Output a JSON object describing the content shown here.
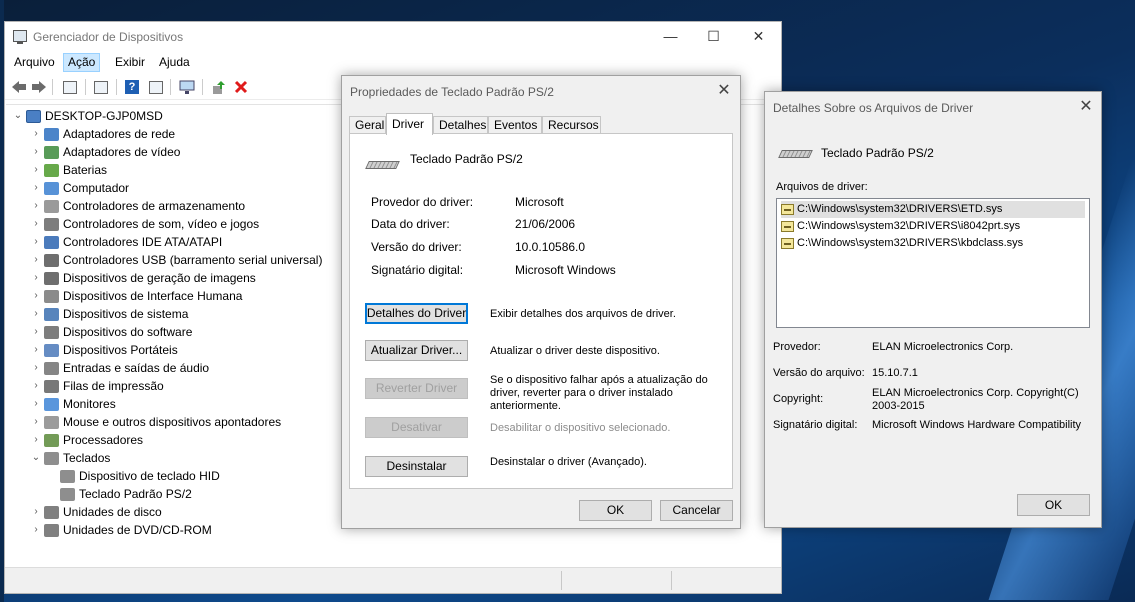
{
  "device_manager": {
    "title": "Gerenciador de Dispositivos",
    "menu": [
      "Arquivo",
      "Ação",
      "Exibir",
      "Ajuda"
    ],
    "window_buttons": {
      "minimize": "—",
      "maximize": "☐",
      "close": "✕"
    },
    "toolbar_icons": [
      "back-icon",
      "forward-icon",
      "properties-icon",
      "view-icon",
      "help-icon",
      "sheet-icon",
      "monitor-icon",
      "update-driver-icon",
      "uninstall-icon"
    ],
    "tree": {
      "root": "DESKTOP-GJP0MSD",
      "items": [
        {
          "label": "Adaptadores de rede",
          "color": "#2c6fbf"
        },
        {
          "label": "Adaptadores de vídeo",
          "color": "#3b8a3b"
        },
        {
          "label": "Baterias",
          "color": "#4c9a2a"
        },
        {
          "label": "Computador",
          "color": "#3a7fd0"
        },
        {
          "label": "Controladores de armazenamento",
          "color": "#888888"
        },
        {
          "label": "Controladores de som, vídeo e jogos",
          "color": "#666666"
        },
        {
          "label": "Controladores IDE ATA/ATAPI",
          "color": "#2b64b0"
        },
        {
          "label": "Controladores USB (barramento serial universal)",
          "color": "#555555"
        },
        {
          "label": "Dispositivos de geração de imagens",
          "color": "#555555"
        },
        {
          "label": "Dispositivos de Interface Humana",
          "color": "#777777"
        },
        {
          "label": "Dispositivos de sistema",
          "color": "#3a6fb0"
        },
        {
          "label": "Dispositivos do software",
          "color": "#666666"
        },
        {
          "label": "Dispositivos Portáteis",
          "color": "#4a78b8"
        },
        {
          "label": "Entradas e saídas de áudio",
          "color": "#707070"
        },
        {
          "label": "Filas de impressão",
          "color": "#606060"
        },
        {
          "label": "Monitores",
          "color": "#3d84d6"
        },
        {
          "label": "Mouse e outros dispositivos apontadores",
          "color": "#8a8a8a"
        },
        {
          "label": "Processadores",
          "color": "#5a8a3a"
        },
        {
          "label": "Teclados",
          "color": "#7a7a7a",
          "expanded": true
        },
        {
          "label": "Dispositivo de teclado HID",
          "color": "#7a7a7a",
          "child": true
        },
        {
          "label": "Teclado Padrão PS/2",
          "color": "#7a7a7a",
          "child": true
        },
        {
          "label": "Unidades de disco",
          "color": "#6a6a6a"
        },
        {
          "label": "Unidades de DVD/CD-ROM",
          "color": "#6a6a6a"
        }
      ]
    }
  },
  "properties": {
    "title": "Propriedades de Teclado Padrão PS/2",
    "tabs": [
      "Geral",
      "Driver",
      "Detalhes",
      "Eventos",
      "Recursos"
    ],
    "selected_tab": "Driver",
    "device_name": "Teclado Padrão PS/2",
    "fields": [
      {
        "label": "Provedor do driver:",
        "value": "Microsoft"
      },
      {
        "label": "Data do driver:",
        "value": "21/06/2006"
      },
      {
        "label": "Versão do driver:",
        "value": "10.0.10586.0"
      },
      {
        "label": "Signatário digital:",
        "value": "Microsoft Windows"
      }
    ],
    "actions": [
      {
        "button": "Detalhes do Driver",
        "desc": "Exibir detalhes dos arquivos de driver.",
        "enabled": true
      },
      {
        "button": "Atualizar Driver...",
        "desc": "Atualizar o driver deste dispositivo.",
        "enabled": true
      },
      {
        "button": "Reverter Driver",
        "desc": "Se o dispositivo falhar após a atualização do driver, reverter para o driver instalado anteriormente.",
        "enabled": false
      },
      {
        "button": "Desativar",
        "desc": "Desabilitar o dispositivo selecionado.",
        "enabled": false
      },
      {
        "button": "Desinstalar",
        "desc": "Desinstalar o driver (Avançado).",
        "enabled": true
      }
    ],
    "ok": "OK",
    "cancel": "Cancelar"
  },
  "details": {
    "title": "Detalhes Sobre os Arquivos de Driver",
    "device_name": "Teclado Padrão PS/2",
    "files_label": "Arquivos de driver:",
    "files": [
      "C:\\Windows\\system32\\DRIVERS\\ETD.sys",
      "C:\\Windows\\system32\\DRIVERS\\i8042prt.sys",
      "C:\\Windows\\system32\\DRIVERS\\kbdclass.sys"
    ],
    "info": [
      {
        "label": "Provedor:",
        "value": "ELAN Microelectronics Corp."
      },
      {
        "label": "Versão do arquivo:",
        "value": "15.10.7.1"
      },
      {
        "label": "Copyright:",
        "value": "ELAN Microelectronics Corp. Copyright(C) 2003-2015"
      },
      {
        "label": "Signatário digital:",
        "value": "Microsoft Windows Hardware Compatibility"
      }
    ],
    "ok": "OK"
  }
}
